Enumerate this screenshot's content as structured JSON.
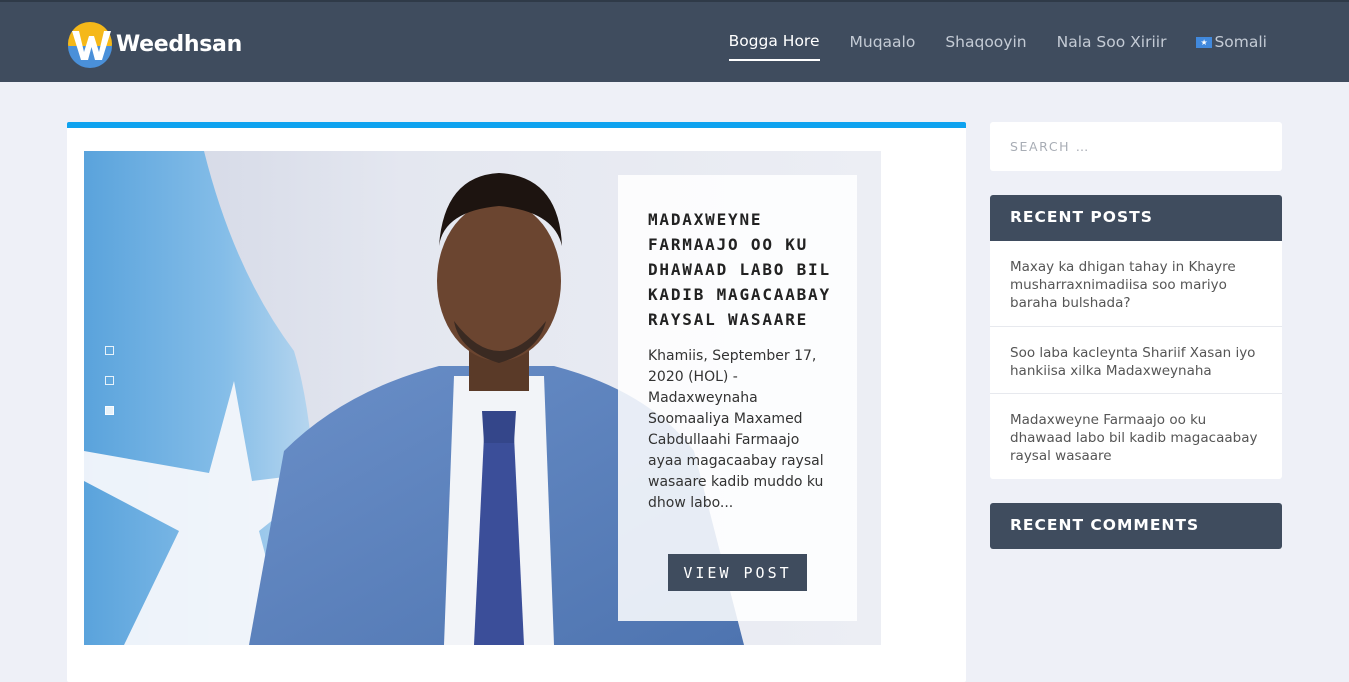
{
  "site": {
    "name": "Weedhsan"
  },
  "nav": {
    "items": [
      {
        "label": "Bogga Hore",
        "active": true
      },
      {
        "label": "Muqaalo",
        "active": false
      },
      {
        "label": "Shaqooyin",
        "active": false
      },
      {
        "label": "Nala Soo Xiriir",
        "active": false
      },
      {
        "label": "Somali",
        "active": false,
        "icon": "somalia-flag-icon"
      }
    ]
  },
  "slider": {
    "slide_count": 3,
    "active_slide": 3,
    "caption": {
      "title": "Madaxweyne Farmaajo oo ku dhawaad labo bil kadib magacaabay raysal wasaare",
      "excerpt": "Khamiis, September 17, 2020 (HOL) - Madaxweynaha Soomaaliya Maxamed Cabdullaahi Farmaajo ayaa magacaabay raysal wasaare kadib muddo ku dhow labo...",
      "button_label": "VIEW POST"
    }
  },
  "search": {
    "placeholder": "Search …"
  },
  "recent_posts": {
    "title": "RECENT POSTS",
    "items": [
      "Maxay ka dhigan tahay in Khayre musharraxnimadiisa soo mariyo baraha bulshada?",
      "Soo laba kacleynta Shariif Xasan iyo hankiisa xilka Madaxweynaha",
      "Madaxweyne Farmaajo oo ku dhawaad labo bil kadib magacaabay raysal wasaare"
    ]
  },
  "recent_comments": {
    "title": "RECENT COMMENTS"
  },
  "colors": {
    "header_bg": "#3f4c5e",
    "accent": "#0ea2ef",
    "page_bg": "#eef0f7",
    "logo_yellow": "#f5b819",
    "logo_blue": "#4a90d9"
  }
}
